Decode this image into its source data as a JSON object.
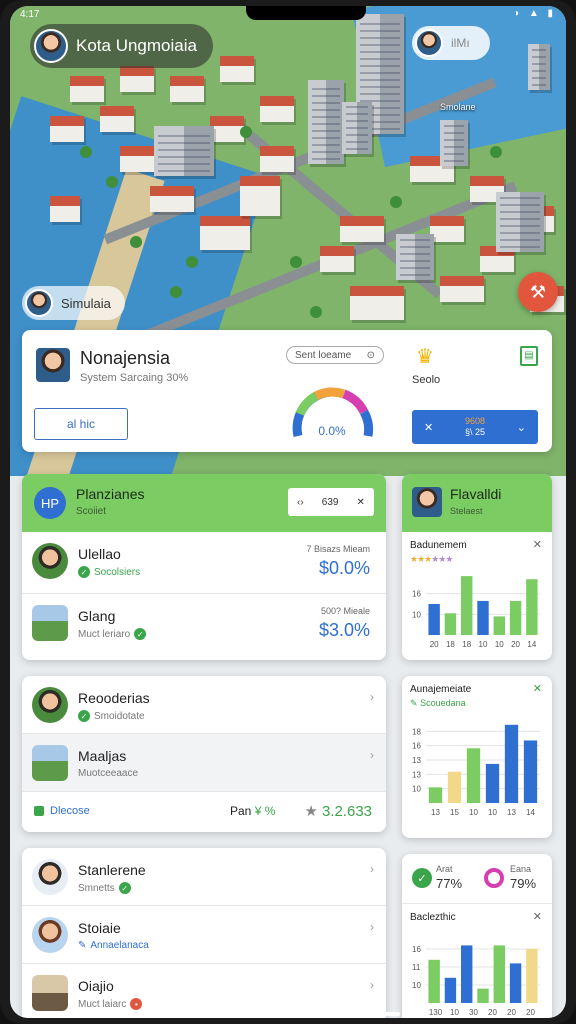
{
  "status": {
    "time": "4:17",
    "icons": "◗ ▲ ▮"
  },
  "top": {
    "title": "Kota Ungmoiaia",
    "user_label": "ilMı",
    "map_tag": "Smolane",
    "sim_label": "Simulaia"
  },
  "profile": {
    "name": "Nonajensia",
    "sub": "System Sarcaing 30%",
    "all_button": "al hic",
    "scene_dropdown": "Sent loeame",
    "gauge_value": "0.0%",
    "gauge_fraction": 0.0,
    "scene_label": "Seolo",
    "mode_button": {
      "icon": "✕",
      "line1": "9608",
      "line2": "§\\ 25"
    }
  },
  "list1": {
    "badge": "HP",
    "title": "Planzianes",
    "sub": "Scoiiet",
    "filter_a": "‹›",
    "filter_b": "639",
    "rows": [
      {
        "name": "Ulellao",
        "tag": "Socolsiers",
        "meta": "7 Bisazs Mieam",
        "pct": "$0.0%"
      },
      {
        "name": "Glang",
        "tag": "Muct leriaro",
        "meta": "500? Mieale",
        "pct": "$3.0%"
      }
    ]
  },
  "list2": {
    "rows": [
      {
        "name": "Reooderias",
        "tag": "Smoidotate"
      },
      {
        "name": "Maaljas",
        "tag": "Muotceeaace"
      }
    ],
    "footer": {
      "left": "Dlecose",
      "mid_label": "Pan",
      "mid_value": "¥ %",
      "right": "3.2.633"
    }
  },
  "list3": {
    "rows": [
      {
        "name": "Stanlerene",
        "tag": "Smnetts"
      },
      {
        "name": "Stoiaie",
        "tag": "Annaelanaca"
      },
      {
        "name": "Oiajio",
        "tag": "Muct laiarc"
      }
    ]
  },
  "side1": {
    "title": "Flavalldi",
    "sub": "Stelaest",
    "mini_title": "Badunemem",
    "stars_gold": "★★★",
    "stars_violet": "★★★",
    "chart_data": {
      "type": "bar",
      "categories": [
        "20",
        "18",
        "18",
        "10",
        "10",
        "20",
        "14"
      ],
      "values": [
        10,
        7,
        19,
        11,
        6,
        11,
        18
      ],
      "y_ticks": [
        "16",
        "10"
      ],
      "ylim": [
        0,
        20
      ],
      "colors": [
        "#2f6fd1",
        "#7acc63",
        "#7acc63",
        "#2f6fd1",
        "#7acc63",
        "#7acc63",
        "#7acc63"
      ]
    }
  },
  "side2": {
    "mini_title": "Aunajemeiate",
    "sub": "Scouedana",
    "chart_data": {
      "type": "bar",
      "categories": [
        "13",
        "15",
        "10",
        "10",
        "13",
        "14"
      ],
      "values": [
        4,
        8,
        14,
        10,
        20,
        16
      ],
      "y_ticks": [
        "18",
        "16",
        "13",
        "13",
        "10"
      ],
      "ylim": [
        0,
        22
      ],
      "colors": [
        "#7acc63",
        "#f2d98a",
        "#7acc63",
        "#2f6fd1",
        "#2f6fd1",
        "#2f6fd1"
      ]
    }
  },
  "side3": {
    "kpi1_label": "Arat",
    "kpi1_value": "77%",
    "kpi2_label": "Eana",
    "kpi2_value": "79%",
    "mini_title": "Baclezthic",
    "chart_data": {
      "type": "bar",
      "categories": [
        "130",
        "10",
        "30",
        "20",
        "20",
        "20"
      ],
      "values": [
        12,
        7,
        16,
        4,
        16,
        11,
        15
      ],
      "y_ticks": [
        "16",
        "11",
        "10"
      ],
      "ylim": [
        0,
        20
      ],
      "colors": [
        "#7acc63",
        "#2f6fd1",
        "#2f6fd1",
        "#7acc63",
        "#7acc63",
        "#2f6fd1",
        "#f2d98a"
      ]
    }
  }
}
